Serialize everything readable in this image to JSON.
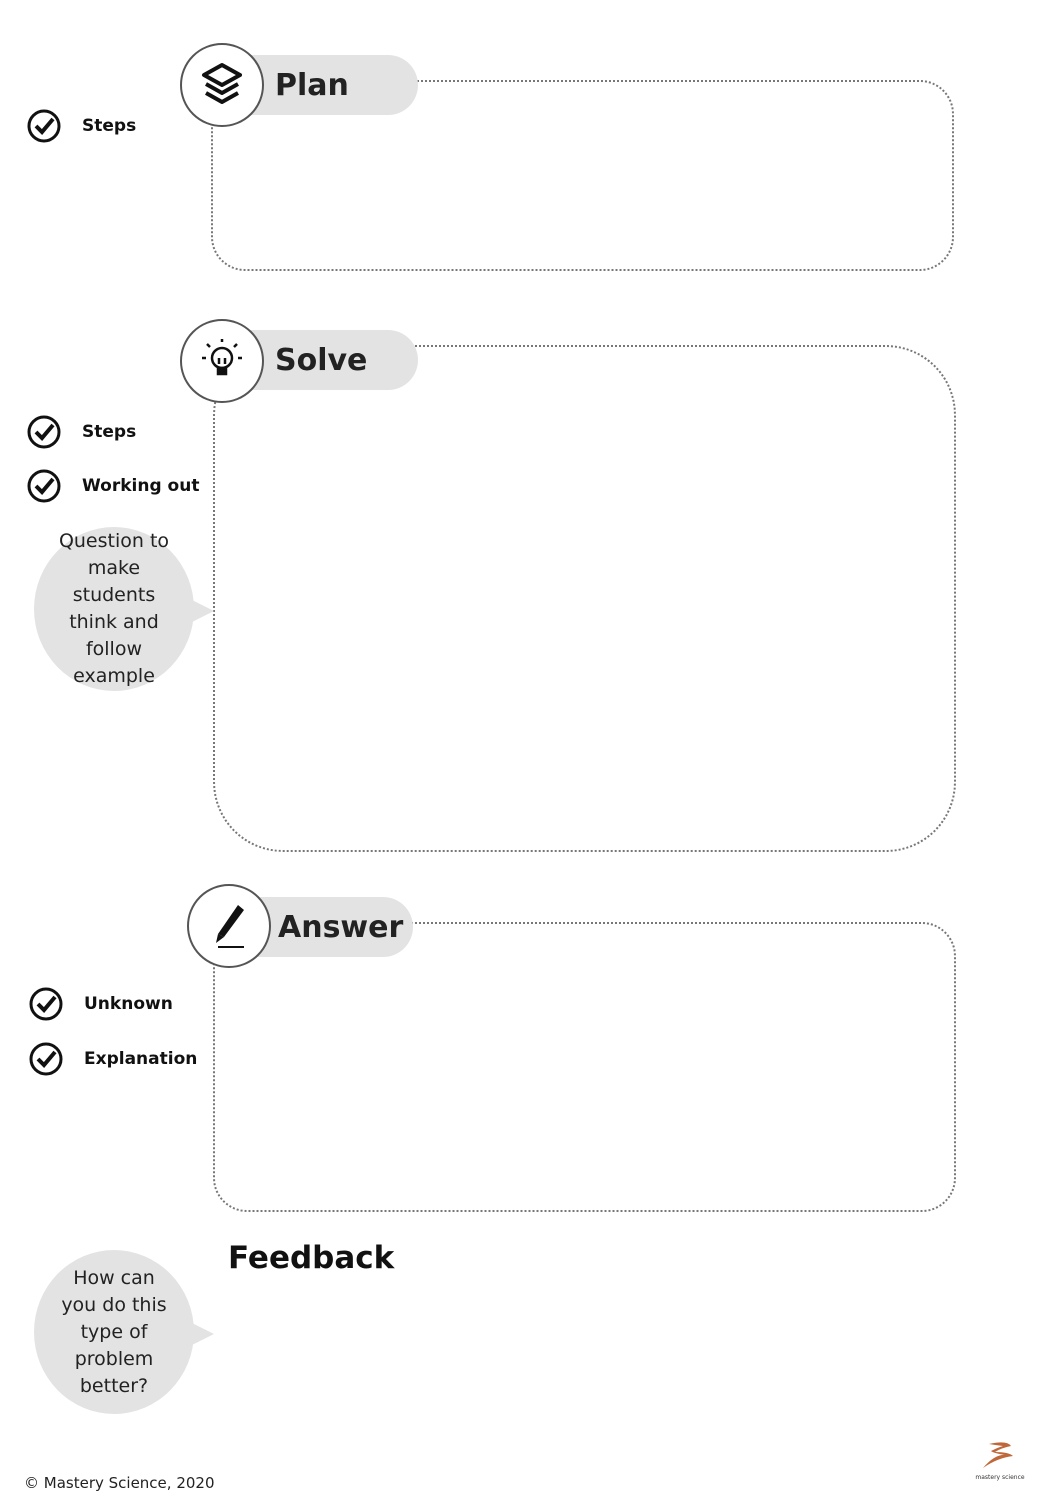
{
  "sections": [
    {
      "title": "Plan",
      "icon": "layers-icon",
      "checks": [
        "Steps"
      ]
    },
    {
      "title": "Solve",
      "icon": "lightbulb-icon",
      "checks": [
        "Steps",
        "Working out"
      ],
      "bubble": "Question to make students think and follow example"
    },
    {
      "title": "Answer",
      "icon": "pen-icon",
      "checks": [
        "Unknown",
        "Explanation"
      ]
    }
  ],
  "feedback": {
    "title": "Feedback",
    "bubble": "How can you do this type of problem better?"
  },
  "footer": {
    "copyright": "© Mastery Science, 2020",
    "logo_text": "mastery science",
    "logo_color": "#c0673a"
  }
}
